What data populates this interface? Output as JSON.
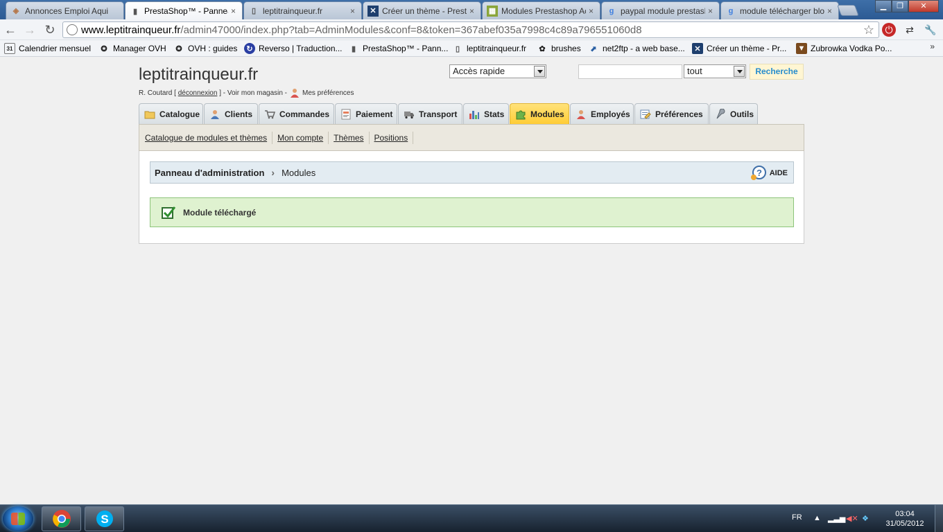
{
  "browser": {
    "tabs": [
      {
        "label": "Annonces Emploi Aqui",
        "favicon": "box-icon",
        "active": false
      },
      {
        "label": "PrestaShop™ - Panneau",
        "favicon": "prestashop-icon",
        "active": true
      },
      {
        "label": "leptitrainqueur.fr",
        "favicon": "page-icon",
        "active": false
      },
      {
        "label": "Créer un thème - Presta",
        "favicon": "cross-icon",
        "active": false
      },
      {
        "label": "Modules Prestashop Ac",
        "favicon": "puzzle-icon",
        "active": false
      },
      {
        "label": "paypal module prestash",
        "favicon": "google-icon",
        "active": false
      },
      {
        "label": "module télécharger blo",
        "favicon": "google-icon",
        "active": false
      }
    ],
    "close_glyph": "×",
    "url": {
      "host": "www.leptitrainqueur.fr",
      "path": "/admin47000/index.php?tab=AdminModules&conf=8&token=367abef035a7998c4c89a796551060d8"
    },
    "bookmarks": [
      {
        "label": "Calendrier mensuel",
        "icon": "calendar-icon"
      },
      {
        "label": "Manager OVH",
        "icon": "ovh-icon"
      },
      {
        "label": "OVH : guides",
        "icon": "ovh-icon"
      },
      {
        "label": "Reverso | Traduction...",
        "icon": "reverso-icon"
      },
      {
        "label": "PrestaShop™ - Pann...",
        "icon": "prestashop-icon"
      },
      {
        "label": "leptitrainqueur.fr",
        "icon": "page-icon"
      },
      {
        "label": "brushes",
        "icon": "brushes-icon"
      },
      {
        "label": "net2ftp - a web base...",
        "icon": "net2ftp-icon"
      },
      {
        "label": "Créer un thème - Pr...",
        "icon": "cross-icon"
      },
      {
        "label": "Zubrowka Vodka Po...",
        "icon": "bottle-icon"
      }
    ],
    "more_glyph": "»"
  },
  "header": {
    "shop_name": "leptitrainqueur.fr",
    "user": "R. Coutard [",
    "logout": "déconnexion",
    "after_logout": "] - Voir mon magasin -",
    "preferences": "Mes préférences",
    "quick_access": "Accès rapide",
    "search_value": "",
    "search_scope": "tout",
    "search_button": "Recherche"
  },
  "nav": {
    "tabs": [
      {
        "label": "Catalogue",
        "icon": "folder-icon",
        "active": false
      },
      {
        "label": "Clients",
        "icon": "user-icon",
        "active": false
      },
      {
        "label": "Commandes",
        "icon": "cart-icon",
        "active": false
      },
      {
        "label": "Paiement",
        "icon": "invoice-icon",
        "active": false
      },
      {
        "label": "Transport",
        "icon": "truck-icon",
        "active": false
      },
      {
        "label": "Stats",
        "icon": "bar-chart-icon",
        "active": false
      },
      {
        "label": "Modules",
        "icon": "puzzle-icon",
        "active": true
      },
      {
        "label": "Employés",
        "icon": "employee-icon",
        "active": false
      },
      {
        "label": "Préférences",
        "icon": "settings-sheet-icon",
        "active": false
      },
      {
        "label": "Outils",
        "icon": "wrench-icon",
        "active": false
      }
    ],
    "subnav": [
      "Catalogue de modules et thèmes",
      "Mon compte",
      "Thèmes",
      "Positions"
    ]
  },
  "breadcrumb": {
    "root": "Panneau d'administration",
    "current": "Modules",
    "help": "AIDE"
  },
  "confirmation": {
    "message": "Module téléchargé"
  },
  "taskbar": {
    "lang": "FR",
    "time": "03:04",
    "date": "31/05/2012"
  },
  "colors": {
    "active_tab": "#ffcc33",
    "confirm_bg": "#dff2d0",
    "confirm_border": "#8dc47a",
    "search_button_text": "#268ccd"
  }
}
